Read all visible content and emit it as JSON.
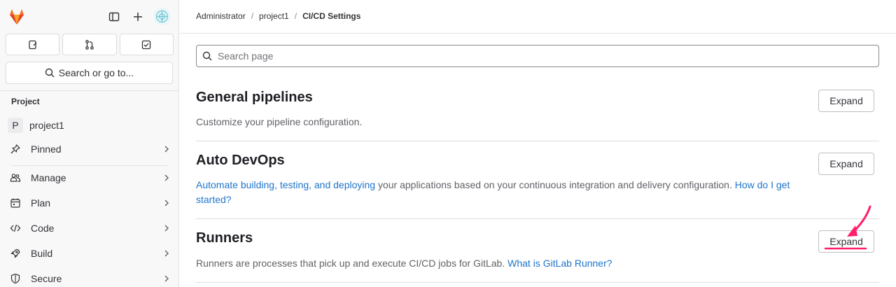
{
  "sidebar": {
    "search_label": "Search or go to...",
    "section_title": "Project",
    "project": {
      "badge": "P",
      "label": "project1"
    },
    "items": [
      {
        "label": "Pinned",
        "icon": "thumbtack-icon"
      },
      {
        "label": "Manage",
        "icon": "users-icon"
      },
      {
        "label": "Plan",
        "icon": "calendar-icon"
      },
      {
        "label": "Code",
        "icon": "code-icon"
      },
      {
        "label": "Build",
        "icon": "rocket-icon"
      },
      {
        "label": "Secure",
        "icon": "shield-icon"
      }
    ]
  },
  "breadcrumb": [
    "Administrator",
    "project1",
    "CI/CD Settings"
  ],
  "search_page": {
    "placeholder": "Search page"
  },
  "sections": [
    {
      "title": "General pipelines",
      "description": "Customize your pipeline configuration.",
      "button": "Expand"
    },
    {
      "title": "Auto DevOps",
      "link1": "Automate building, testing, and deploying",
      "text": " your applications based on your continuous integration and delivery configuration. ",
      "link2": "How do I get started?",
      "button": "Expand"
    },
    {
      "title": "Runners",
      "text": "Runners are processes that pick up and execute CI/CD jobs for GitLab. ",
      "link": "What is GitLab Runner?",
      "button": "Expand"
    }
  ],
  "colors": {
    "link": "#1f75cb",
    "annotation": "#ff1f6a",
    "brand_orange": "#fc6d26"
  }
}
